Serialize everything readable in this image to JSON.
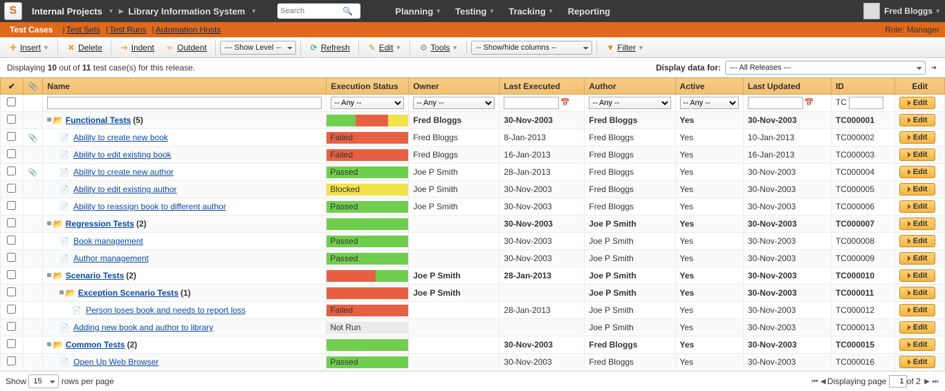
{
  "top": {
    "logo": "S",
    "breadcrumb1": "Internal Projects",
    "breadcrumb2": "Library Information System",
    "search_placeholder": "Search",
    "nav": {
      "planning": "Planning",
      "testing": "Testing",
      "tracking": "Tracking",
      "reporting": "Reporting"
    },
    "username": "Fred Bloggs"
  },
  "subnav": {
    "items": [
      "Test Cases",
      "Test Sets",
      "Test Runs",
      "Automation Hosts"
    ],
    "active": 0,
    "role": "Role: Manager"
  },
  "toolbar": {
    "insert": "Insert",
    "delete": "Delete",
    "indent": "Indent",
    "outdent": "Outdent",
    "showlevel": "--- Show Level ---",
    "refresh": "Refresh",
    "edit": "Edit",
    "tools": "Tools",
    "showhide": "-- Show/hide columns --",
    "filter": "Filter"
  },
  "status": {
    "text_pre": "Displaying ",
    "n1": "10",
    "mid": " out of ",
    "n2": "11",
    "post": " test case(s) for this release.",
    "display_for": "Display data for:",
    "releases": "--- All Releases ---"
  },
  "columns": {
    "name": "Name",
    "exec": "Execution Status",
    "owner": "Owner",
    "lastexec": "Last Executed",
    "author": "Author",
    "active": "Active",
    "lastupd": "Last Updated",
    "id": "ID",
    "edit": "Edit"
  },
  "filters": {
    "any": "-- Any --",
    "tc": "TC",
    "edit": "Edit"
  },
  "rows": [
    {
      "indent": 0,
      "type": "folder",
      "name": "Functional Tests",
      "count": "(5)",
      "bars": [
        [
          "g",
          35
        ],
        [
          "r",
          40
        ],
        [
          "y",
          25
        ]
      ],
      "owner": "Fred Bloggs",
      "lastexec": "30-Nov-2003",
      "author": "Fred Bloggs",
      "active": "Yes",
      "lastupd": "30-Nov-2003",
      "id": "TC000001",
      "bold": true,
      "attach": false
    },
    {
      "indent": 1,
      "type": "case",
      "name": "Ability to create new book",
      "status": "Failed",
      "color": "r",
      "owner": "Fred Bloggs",
      "lastexec": "8-Jan-2013",
      "author": "Fred Bloggs",
      "active": "Yes",
      "lastupd": "10-Jan-2013",
      "id": "TC000002",
      "attach": true
    },
    {
      "indent": 1,
      "type": "case",
      "name": "Ability to edit existing book",
      "status": "Failed",
      "color": "r",
      "owner": "Fred Bloggs",
      "lastexec": "16-Jan-2013",
      "author": "Fred Bloggs",
      "active": "Yes",
      "lastupd": "16-Jan-2013",
      "id": "TC000003",
      "attach": false
    },
    {
      "indent": 1,
      "type": "case",
      "name": "Ability to create new author",
      "status": "Passed",
      "color": "g",
      "owner": "Joe P Smith",
      "lastexec": "28-Jan-2013",
      "author": "Fred Bloggs",
      "active": "Yes",
      "lastupd": "30-Nov-2003",
      "id": "TC000004",
      "attach": true
    },
    {
      "indent": 1,
      "type": "case",
      "name": "Ability to edit existing author",
      "status": "Blocked",
      "color": "y",
      "owner": "Joe P Smith",
      "lastexec": "30-Nov-2003",
      "author": "Fred Bloggs",
      "active": "Yes",
      "lastupd": "30-Nov-2003",
      "id": "TC000005",
      "attach": false
    },
    {
      "indent": 1,
      "type": "case",
      "name": "Ability to reassign book to different author",
      "status": "Passed",
      "color": "g",
      "owner": "Joe P Smith",
      "lastexec": "30-Nov-2003",
      "author": "Fred Bloggs",
      "active": "Yes",
      "lastupd": "30-Nov-2003",
      "id": "TC000006",
      "attach": false
    },
    {
      "indent": 0,
      "type": "folder",
      "name": "Regression Tests",
      "count": "(2)",
      "bars": [
        [
          "g",
          100
        ]
      ],
      "owner": "",
      "lastexec": "30-Nov-2003",
      "author": "Joe P Smith",
      "active": "Yes",
      "lastupd": "30-Nov-2003",
      "id": "TC000007",
      "bold": true,
      "attach": false
    },
    {
      "indent": 1,
      "type": "case",
      "name": "Book management",
      "status": "Passed",
      "color": "g",
      "owner": "",
      "lastexec": "30-Nov-2003",
      "author": "Joe P Smith",
      "active": "Yes",
      "lastupd": "30-Nov-2003",
      "id": "TC000008",
      "attach": false
    },
    {
      "indent": 1,
      "type": "case",
      "name": "Author management",
      "status": "Passed",
      "color": "g",
      "owner": "",
      "lastexec": "30-Nov-2003",
      "author": "Joe P Smith",
      "active": "Yes",
      "lastupd": "30-Nov-2003",
      "id": "TC000009",
      "attach": false
    },
    {
      "indent": 0,
      "type": "folder",
      "name": "Scenario Tests",
      "count": "(2)",
      "bars": [
        [
          "r",
          60
        ],
        [
          "g",
          40
        ]
      ],
      "owner": "Joe P Smith",
      "lastexec": "28-Jan-2013",
      "author": "Joe P Smith",
      "active": "Yes",
      "lastupd": "30-Nov-2003",
      "id": "TC000010",
      "bold": true,
      "attach": false
    },
    {
      "indent": 1,
      "type": "folder",
      "name": "Exception Scenario Tests",
      "count": "(1)",
      "bars": [
        [
          "r",
          100
        ]
      ],
      "owner": "Joe P Smith",
      "lastexec": "",
      "author": "Joe P Smith",
      "active": "Yes",
      "lastupd": "30-Nov-2003",
      "id": "TC000011",
      "bold": true,
      "attach": false
    },
    {
      "indent": 2,
      "type": "case",
      "name": "Person loses book and needs to report loss",
      "status": "Failed",
      "color": "r",
      "owner": "",
      "lastexec": "28-Jan-2013",
      "author": "Joe P Smith",
      "active": "Yes",
      "lastupd": "30-Nov-2003",
      "id": "TC000012",
      "attach": false
    },
    {
      "indent": 1,
      "type": "case",
      "name": "Adding new book and author to library",
      "status": "Not Run",
      "color": "w",
      "owner": "",
      "lastexec": "",
      "author": "Joe P Smith",
      "active": "Yes",
      "lastupd": "30-Nov-2003",
      "id": "TC000013",
      "attach": false
    },
    {
      "indent": 0,
      "type": "folder",
      "name": "Common Tests",
      "count": "(2)",
      "bars": [
        [
          "g",
          100
        ]
      ],
      "owner": "",
      "lastexec": "30-Nov-2003",
      "author": "Fred Bloggs",
      "active": "Yes",
      "lastupd": "30-Nov-2003",
      "id": "TC000015",
      "bold": true,
      "attach": false
    },
    {
      "indent": 1,
      "type": "case",
      "name": "Open Up Web Browser",
      "status": "Passed",
      "color": "g",
      "owner": "",
      "lastexec": "30-Nov-2003",
      "author": "Fred Bloggs",
      "active": "Yes",
      "lastupd": "30-Nov-2003",
      "id": "TC000016",
      "attach": false
    }
  ],
  "pager": {
    "show": "Show",
    "rpp": "rows per page",
    "perpage": "15",
    "disp": "Displaying page",
    "page": "1",
    "of": " of 2"
  },
  "editbtn": "Edit"
}
